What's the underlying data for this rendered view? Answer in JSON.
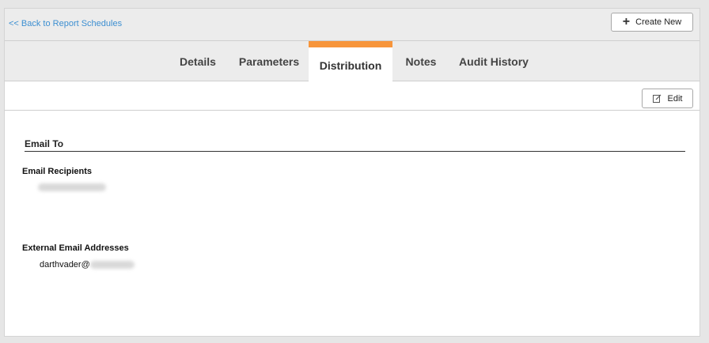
{
  "header": {
    "back_link": "<< Back to Report Schedules",
    "create_new_label": "Create New"
  },
  "tabs": [
    {
      "label": "Details",
      "active": false
    },
    {
      "label": "Parameters",
      "active": false
    },
    {
      "label": "Distribution",
      "active": true
    },
    {
      "label": "Notes",
      "active": false
    },
    {
      "label": "Audit History",
      "active": false
    }
  ],
  "toolbar": {
    "edit_label": "Edit"
  },
  "distribution": {
    "section_title": "Email To",
    "email_recipients_label": "Email Recipients",
    "external_emails_label": "External Email Addresses",
    "external_email_prefix": "darthvader@"
  },
  "colors": {
    "accent": "#f7953b",
    "link": "#3d8fd1"
  },
  "icons": {
    "create": "plus-icon",
    "edit": "edit-icon"
  }
}
